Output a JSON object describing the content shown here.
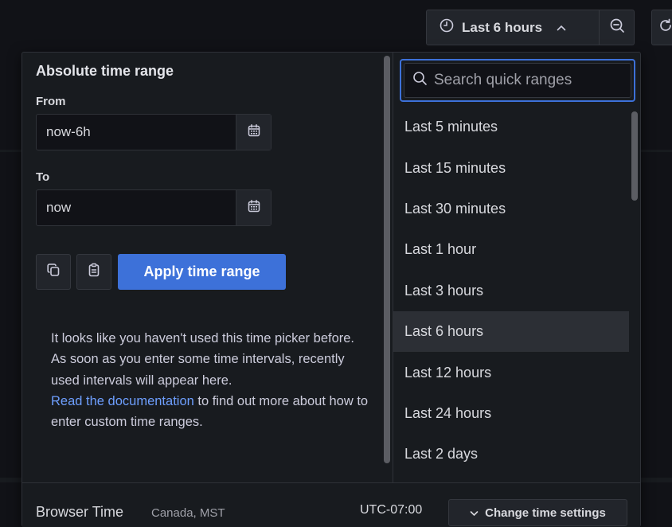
{
  "toolbar": {
    "time_range_label": "Last 6 hours"
  },
  "absolute": {
    "title": "Absolute time range",
    "from_label": "From",
    "from_value": "now-6h",
    "to_label": "To",
    "to_value": "now",
    "apply_label": "Apply time range"
  },
  "help": {
    "text": "It looks like you haven't used this time picker before. As soon as you enter some time intervals, recently used intervals will appear here.",
    "link_text": "Read the documentation",
    "link_suffix": " to find out more about how to enter custom time ranges."
  },
  "quick": {
    "search_placeholder": "Search quick ranges",
    "items": [
      {
        "label": "Last 5 minutes"
      },
      {
        "label": "Last 15 minutes"
      },
      {
        "label": "Last 30 minutes"
      },
      {
        "label": "Last 1 hour"
      },
      {
        "label": "Last 3 hours"
      },
      {
        "label": "Last 6 hours",
        "selected": true
      },
      {
        "label": "Last 12 hours"
      },
      {
        "label": "Last 24 hours"
      },
      {
        "label": "Last 2 days"
      }
    ]
  },
  "footer": {
    "tz_title": "Browser Time",
    "tz_region": "Canada, MST",
    "utc_offset": "UTC-07:00",
    "settings_label": "Change time settings"
  },
  "colors": {
    "background": "#111217",
    "panel": "#181b1f",
    "accent": "#3d71d9",
    "link": "#6e9fff"
  },
  "icons": {
    "time_button": "clock-icon",
    "time_caret": "chevron-up-icon",
    "zoom": "zoom-out-icon",
    "refresh": "refresh-icon",
    "date_picker": "calendar-icon",
    "copy": "copy-icon",
    "paste": "clipboard-icon",
    "search": "search-icon",
    "settings_caret": "chevron-down-icon"
  }
}
